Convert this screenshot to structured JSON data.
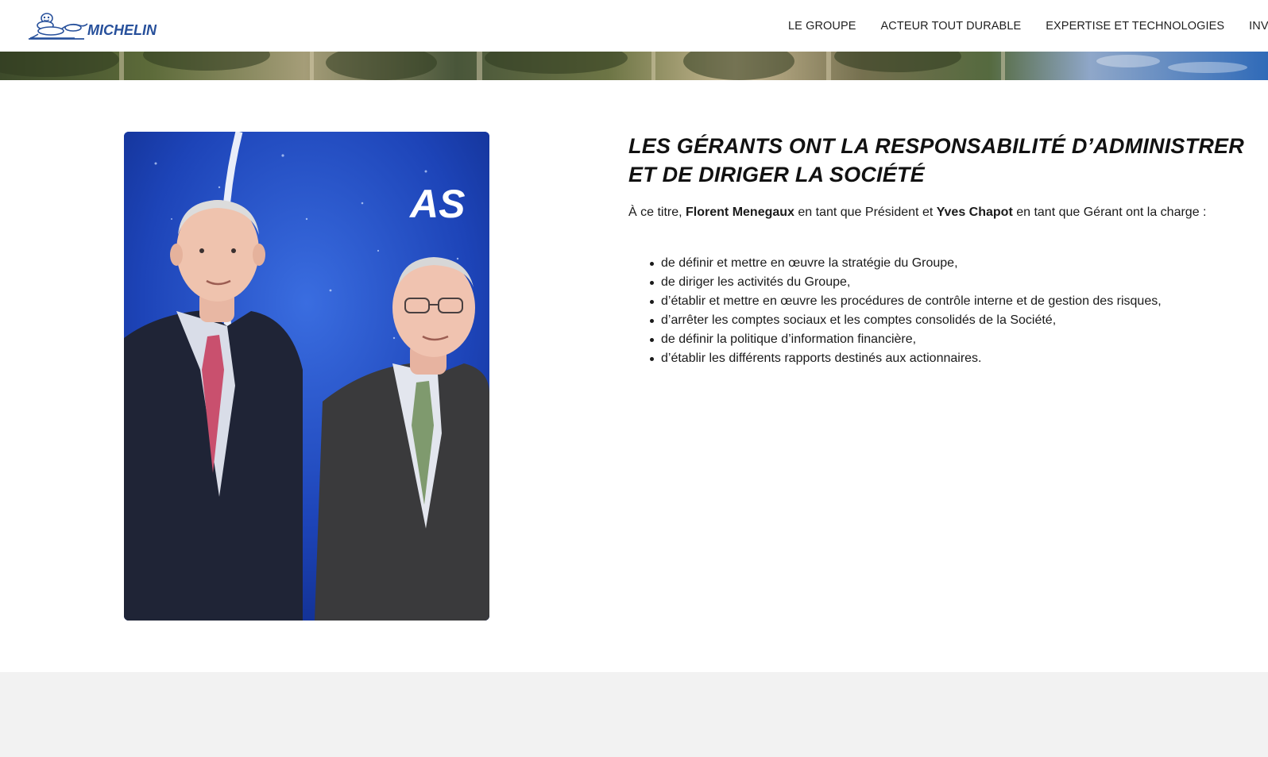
{
  "brand": {
    "name": "MICHELIN",
    "primary_color": "#27509b",
    "accent_color": "#fce500"
  },
  "nav": {
    "items": [
      {
        "label": "LE GROUPE"
      },
      {
        "label": "ACTEUR TOUT DURABLE"
      },
      {
        "label": "EXPERTISE ET TECHNOLOGIES"
      },
      {
        "label": "INVESTISSEU"
      }
    ]
  },
  "banner": {
    "icon": "trees-sky-image"
  },
  "photo": {
    "icon": "two-executives-photo",
    "backdrop_text": "AS"
  },
  "section": {
    "title": "LES GÉRANTS ONT LA RESPONSABILITÉ D’ADMINISTRER ET DE DIRIGER LA SOCIÉTÉ",
    "intro": {
      "prefix": "À ce titre, ",
      "name1": "Florent Menegaux",
      "middle": " en tant que Président et ",
      "name2": "Yves Chapot",
      "suffix": " en tant que Gérant ont la charge :"
    },
    "duties": [
      "de définir et mettre en œuvre la stratégie du Groupe,",
      "de diriger les activités du Groupe,",
      "d’établir et mettre en œuvre les procédures de contrôle interne et de gestion des risques,",
      "d’arrêter les comptes sociaux et les comptes consolidés de la Société,",
      "de définir la politique d’information financière,",
      "d’établir les différents rapports destinés aux actionnaires."
    ]
  }
}
